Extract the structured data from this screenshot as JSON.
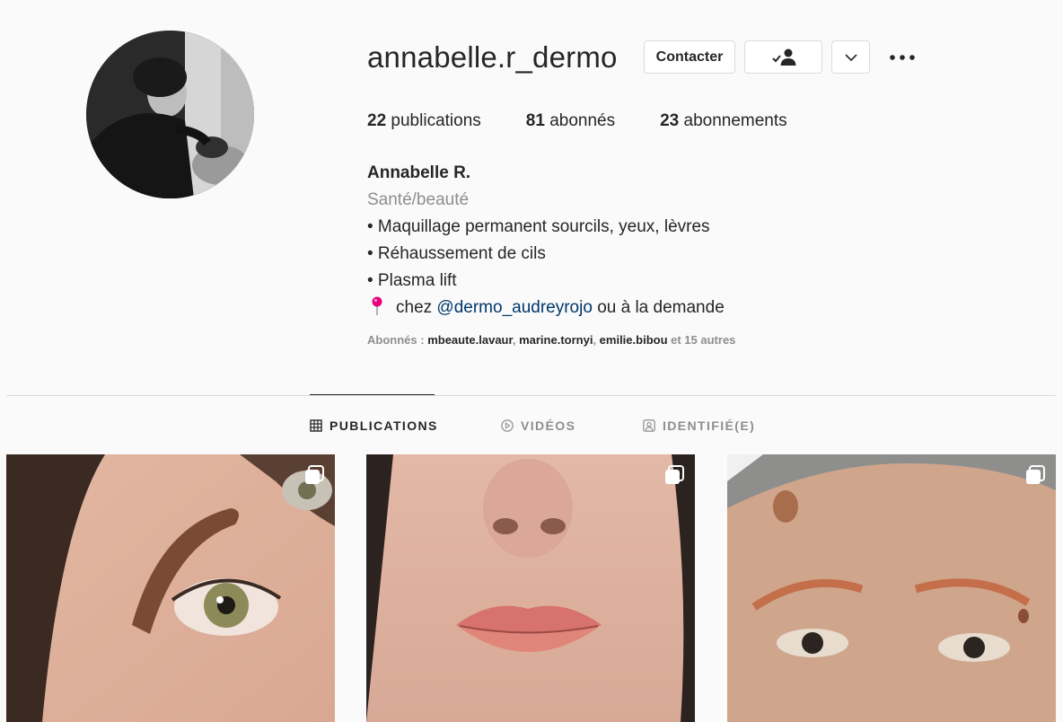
{
  "profile": {
    "username": "annabelle.r_dermo",
    "buttons": {
      "contact_label": "Contacter",
      "following_icon": "person-check-icon",
      "dropdown_icon": "chevron-down-icon",
      "more_icon": "more-horizontal-icon"
    },
    "stats": [
      {
        "count": "22",
        "label": "publications"
      },
      {
        "count": "81",
        "label": "abonnés"
      },
      {
        "count": "23",
        "label": "abonnements"
      }
    ],
    "bio": {
      "name": "Annabelle R.",
      "category": "Santé/beauté",
      "lines": [
        "• Maquillage permanent sourcils, yeux, lèvres",
        "• Réhaussement de cils",
        "• Plasma lift"
      ],
      "location_prefix": "chez",
      "location_mention": "@dermo_audreyrojo",
      "location_suffix": "ou à la demande"
    },
    "followed_by": {
      "prefix": "Abonnés :",
      "users": [
        "mbeaute.lavaur",
        "marine.tornyi",
        "emilie.bibou"
      ],
      "suffix": "et 15 autres"
    }
  },
  "tabs": [
    {
      "label": "PUBLICATIONS",
      "icon": "grid-icon",
      "active": true
    },
    {
      "label": "VIDÉOS",
      "icon": "play-circle-icon",
      "active": false
    },
    {
      "label": "IDENTIFIÉ(E)",
      "icon": "tagged-user-icon",
      "active": false
    }
  ],
  "posts": [
    {
      "subject": "eyebrow",
      "multi_icon": "carousel-icon"
    },
    {
      "subject": "lips",
      "multi_icon": "carousel-icon"
    },
    {
      "subject": "eyebrows-mature",
      "multi_icon": "carousel-icon"
    }
  ],
  "colors": {
    "background": "#fafafa",
    "text": "#262626",
    "secondary": "#8e8e8e",
    "mention": "#00376b",
    "border": "#dbdbdb",
    "pin": "#e6007e"
  }
}
